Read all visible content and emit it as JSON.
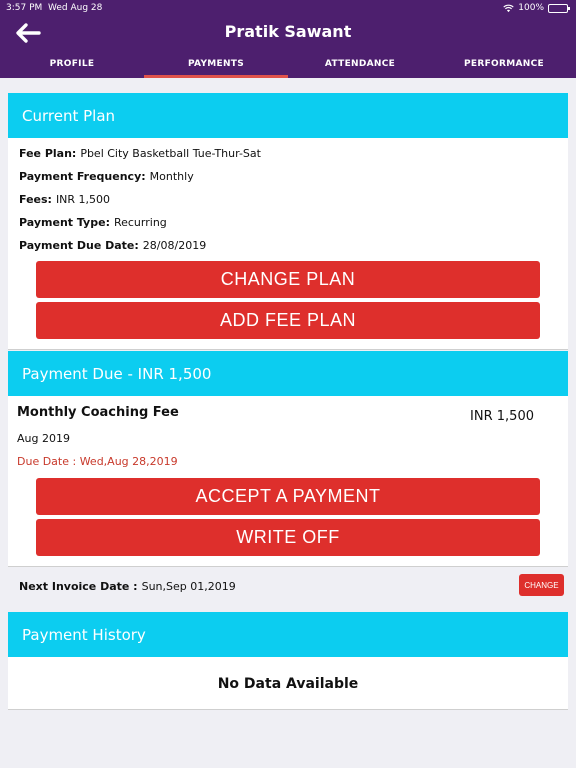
{
  "statusbar": {
    "time": "3:57 PM",
    "date": "Wed Aug 28",
    "battery": "100%"
  },
  "header": {
    "title": "Pratik Sawant"
  },
  "tabs": [
    {
      "label": "PROFILE"
    },
    {
      "label": "PAYMENTS"
    },
    {
      "label": "ATTENDANCE"
    },
    {
      "label": "PERFORMANCE"
    }
  ],
  "current_plan": {
    "heading": "Current Plan",
    "fee_plan_label": "Fee Plan:",
    "fee_plan_value": "Pbel City Basketball Tue-Thur-Sat",
    "frequency_label": "Payment Frequency:",
    "frequency_value": "Monthly",
    "fees_label": "Fees:",
    "fees_value": "INR 1,500",
    "type_label": "Payment Type:",
    "type_value": "Recurring",
    "due_label": "Payment Due Date:",
    "due_value": "28/08/2019",
    "change_plan_button": "CHANGE PLAN",
    "add_fee_plan_button": "ADD FEE PLAN"
  },
  "payment_due": {
    "heading": "Payment Due - INR 1,500",
    "fee_name": "Monthly Coaching Fee",
    "amount": "INR 1,500",
    "month": "Aug 2019",
    "due_date": "Due Date : Wed,Aug 28,2019",
    "accept_button": "ACCEPT A PAYMENT",
    "write_off_button": "WRITE OFF"
  },
  "invoice": {
    "label": "Next Invoice Date :",
    "value": "Sun,Sep 01,2019",
    "change_button": "CHANGE"
  },
  "payment_history": {
    "heading": "Payment History",
    "empty_text": "No Data Available"
  },
  "colors": {
    "header_bg": "#4d1f6e",
    "section_header": "#0ccdf0",
    "button_red": "#de2f2c",
    "tab_indicator": "#e0524a",
    "due_text": "#c8392b"
  }
}
